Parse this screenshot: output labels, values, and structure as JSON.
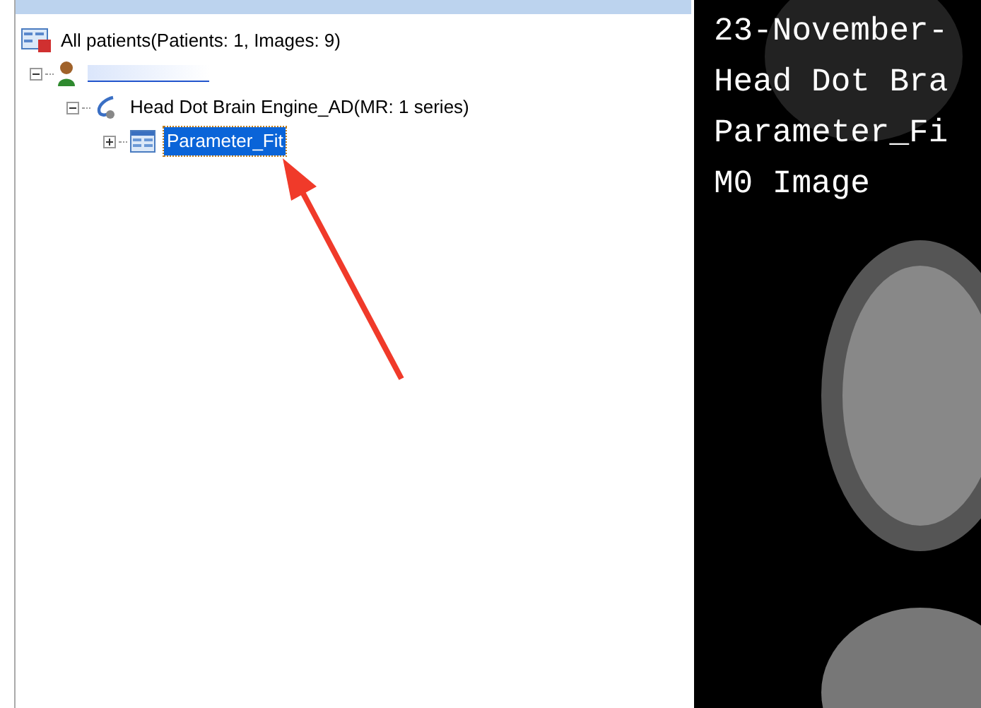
{
  "tree": {
    "label": "All patients(Patients: 1, Images: 9)",
    "children": [
      {
        "kind": "patient",
        "expanded": true,
        "selected": false,
        "children": [
          {
            "kind": "study",
            "label": "Head Dot Brain Engine_AD(MR: 1 series)",
            "expanded": true,
            "selected": false,
            "children": [
              {
                "kind": "series",
                "label": "Parameter_Fit",
                "expanded": false,
                "selected": true
              }
            ]
          }
        ]
      }
    ]
  },
  "viewer": {
    "overlay_lines": [
      "23-November-",
      "Head Dot Bra",
      "Parameter_Fi",
      "M0 Image"
    ]
  }
}
